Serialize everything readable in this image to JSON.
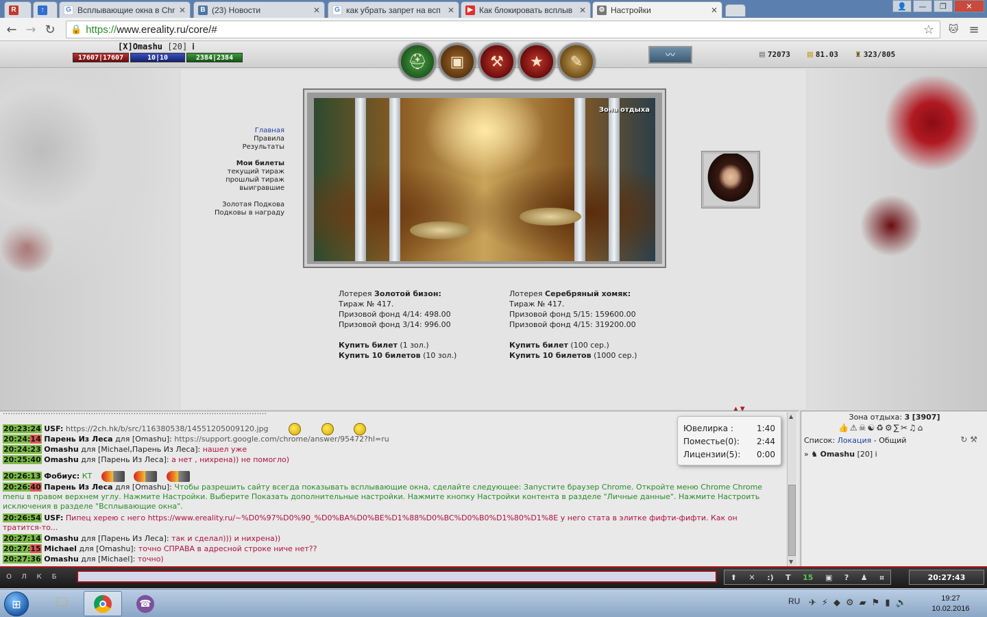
{
  "browser": {
    "tabs": [
      {
        "label": "",
        "icon": "ereality-favicon"
      },
      {
        "label": "",
        "icon": "bookmark-arrow-icon"
      },
      {
        "label": "Всплывающие окна в Chr",
        "icon": "google-icon"
      },
      {
        "label": "(23) Новости",
        "icon": "vk-icon"
      },
      {
        "label": "как убрать запрет на всп",
        "icon": "google-icon"
      },
      {
        "label": "Как блокировать всплыв",
        "icon": "youtube-icon"
      },
      {
        "label": "Настройки",
        "icon": "gear-icon"
      }
    ],
    "url_scheme": "https://",
    "url_rest": "www.ereality.ru/core/#"
  },
  "player": {
    "clan": "[X]",
    "name": "Omashu",
    "level": "[20]",
    "hp": "17607|17607",
    "mp": "10|10",
    "exp": "2384|2384"
  },
  "currency": {
    "silver": "72073",
    "gold": "81.03",
    "weight": "323/805"
  },
  "menu": {
    "main": "Главная",
    "rules": "Правила",
    "results": "Результаты",
    "my_tickets": "Мои билеты",
    "current_draw": "текущий тираж",
    "previous_draw": "прошлый тираж",
    "winning": "выигравшие",
    "golden_horseshoe": "Золотая Подкова",
    "horseshoe_reward": "Подковы в награду"
  },
  "location": {
    "zone_label": "Зона отдыха"
  },
  "lottery_gold": {
    "prefix": "Лотерея",
    "name": "Золотой бизон:",
    "draw": "Тираж № 417.",
    "fund1": "Призовой фонд 4/14: 498.00",
    "fund2": "Призовой фонд 3/14: 996.00",
    "buy1_label": "Купить билет",
    "buy1_price": "(1 зол.)",
    "buy10_label": "Купить 10 билетов",
    "buy10_price": "(10 зол.)"
  },
  "lottery_silver": {
    "prefix": "Лотерея",
    "name": "Серебряный хомяк:",
    "draw": "Тираж № 417.",
    "fund1": "Призовой фонд 5/15: 159600.00",
    "fund2": "Призовой фонд 4/15: 319200.00",
    "buy1_label": "Купить билет",
    "buy1_price": "(100 сер.)",
    "buy10_label": "Купить 10 билетов",
    "buy10_price": "(1000 сер.)"
  },
  "chat": {
    "lines": [
      {
        "time": "20:23:24",
        "nick": "USF:",
        "text": "https://2ch.hk/b/src/116380538/14551205009120.jpg"
      },
      {
        "time_a": "20:24:",
        "time_b": "14",
        "nick": "Парень Из Леса",
        "to": "для [Omashu]:",
        "text": "https://support.google.com/chrome/answer/95472?hl=ru"
      },
      {
        "time": "20:24:23",
        "nick": "Omashu",
        "to": "для [Michael,Парень Из Леса]:",
        "text": "нашел уже"
      },
      {
        "time": "20:25:40",
        "nick": "Omashu",
        "to": "для [Парень Из Леса]:",
        "text": "а нет , нихрена)) не помогло)"
      },
      {
        "time": "20:26:13",
        "nick": "Фобиус:",
        "text": "КТ"
      },
      {
        "time_a": "20:26:",
        "time_b": "40",
        "nick": "Парень Из Леса",
        "to": "для [Omashu]:",
        "text": "Чтобы разрешить сайту всегда показывать всплывающие окна, сделайте следующее: Запустите браузер Chrome. Откройте меню Chrome Chrome menu в правом верхнем углу. Нажмите Настройки. Выберите Показать дополнительные настройки. Нажмите кнопку Настройки контента в разделе \"Личные данные\". Нажмите Настроить исключения в разделе \"Всплывающие окна\"."
      },
      {
        "time": "20:26:54",
        "nick": "USF:",
        "text": "Пипец херею с него https://www.ereality.ru/~%D0%97%D0%90_%D0%BA%D0%BE%D1%88%D0%BC%D0%B0%D1%80%D1%8E у него стата в элитке фифти-фифти. Как он тратится-то..."
      },
      {
        "time": "20:27:14",
        "nick": "Omashu",
        "to": "для [Парень Из Леса]:",
        "text": "так и сделал))) и нихрена))"
      },
      {
        "time_a": "20:27:",
        "time_b": "15",
        "nick": "Michael",
        "to": "для [Omashu]:",
        "text": "точно СПРАВА в адресной строке ниче нет??"
      },
      {
        "time": "20:27:36",
        "nick": "Omashu",
        "to": "для [Michael]:",
        "text": "точно)"
      }
    ]
  },
  "timers": {
    "jewel_label": "Ювелирка :",
    "jewel_value": "1:40",
    "premises_label": "Поместье(0):",
    "premises_value": "2:44",
    "license_label": "Лицензии(5):",
    "license_value": "0:00"
  },
  "users": {
    "zone_name": "Зона отдыха:",
    "zone_count": "3",
    "zone_id": "[3907]",
    "list_label": "Список:",
    "list_link": "Локация",
    "list_suffix": "- Общий",
    "user_name": "Omashu",
    "user_level": "[20]"
  },
  "chatbar": {
    "left_keys": [
      "О",
      "Л",
      "К",
      "Б"
    ],
    "tool_t": "T",
    "tool_count": "15",
    "tool_q": "?",
    "time": "20:27:43"
  },
  "taskbar": {
    "lang": "RU",
    "time": "19:27",
    "date": "10.02.2016"
  }
}
